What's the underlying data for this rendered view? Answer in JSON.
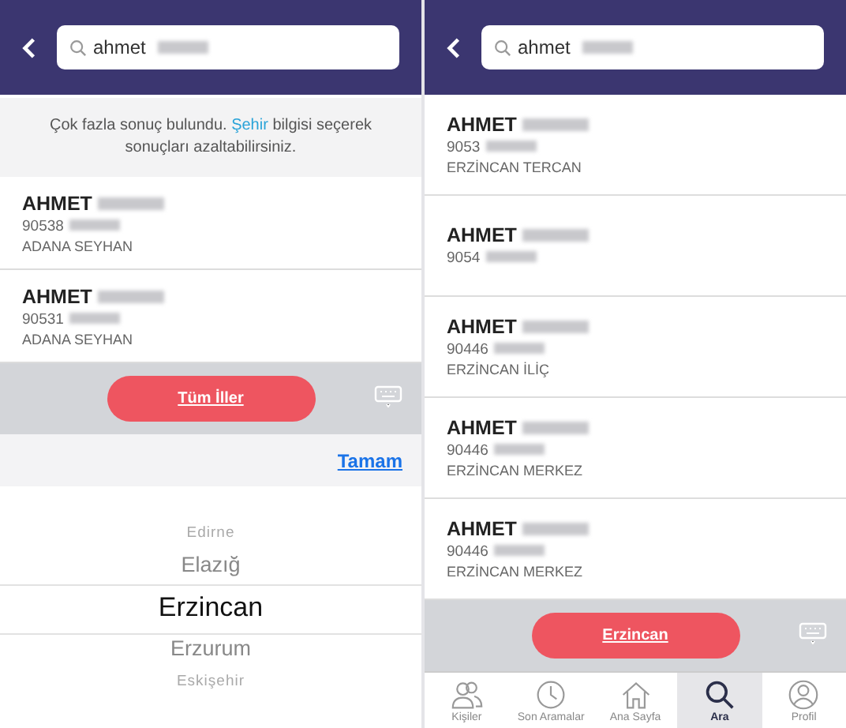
{
  "left": {
    "search": {
      "value": "ahmet"
    },
    "notice": "Çok fazla sonuç bulundu. **Şehir** bilgisi seçerek sonuçları azaltabilirsiniz.",
    "results": [
      {
        "name": "AHMET",
        "number": "90538",
        "location": "ADANA SEYHAN"
      },
      {
        "name": "AHMET",
        "number": "90531",
        "location": "ADANA SEYHAN"
      }
    ],
    "filter_button": "Tüm İller",
    "done_link": "Tamam",
    "picker": [
      {
        "label": "Edirne",
        "selected": false
      },
      {
        "label": "Elazığ",
        "selected": false
      },
      {
        "label": "Erzincan",
        "selected": true
      },
      {
        "label": "Erzurum",
        "selected": false
      },
      {
        "label": "Eskişehir",
        "selected": false
      }
    ]
  },
  "right": {
    "search": {
      "value": "ahmet"
    },
    "results": [
      {
        "name": "AHMET",
        "number": "9053",
        "location": "ERZİNCAN TERCAN"
      },
      {
        "name": "AHMET",
        "number": "9054"
      },
      {
        "name": "AHMET",
        "number": "90446",
        "location": "ERZİNCAN İLİÇ"
      },
      {
        "name": "AHMET",
        "number": "90446",
        "location": "ERZİNCAN MERKEZ"
      },
      {
        "name": "AHMET",
        "number": "90446",
        "location": "ERZİNCAN MERKEZ"
      }
    ],
    "filter_button": "Erzincan",
    "tabs": [
      {
        "label": "Kişiler",
        "selected": false
      },
      {
        "label": "Son Aramalar",
        "selected": false
      },
      {
        "label": "Ana Sayfa",
        "selected": false
      },
      {
        "label": "Ara",
        "selected": true
      },
      {
        "label": "Profil",
        "selected": false
      }
    ]
  }
}
